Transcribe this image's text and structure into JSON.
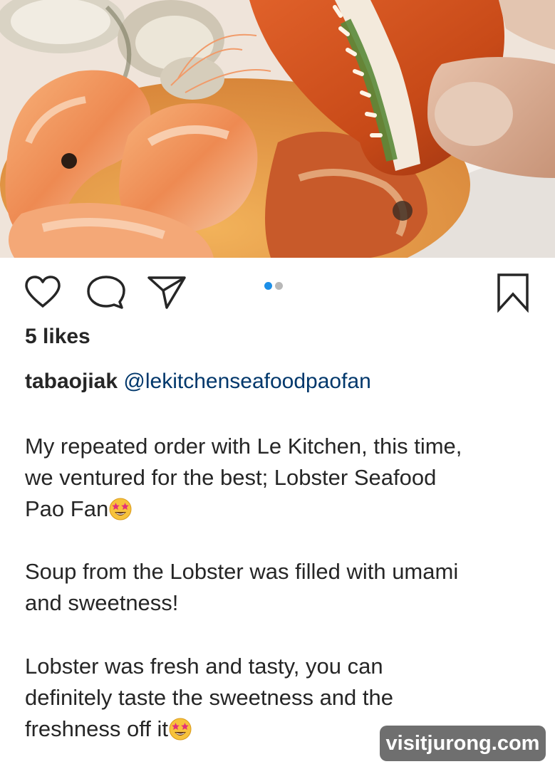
{
  "post": {
    "photo_description": "",
    "carousel": {
      "count": 2,
      "active_index": 0
    },
    "likes_text": "5 likes",
    "author": "tabaojiak",
    "mention": "@lekitchenseafoodpaofan",
    "caption": {
      "paragraph1": {
        "line1": "My repeated order with Le Kitchen, this time,",
        "line2": "we ventured for the best; Lobster Seafood",
        "line3": "Pao Fan"
      },
      "paragraph2": {
        "line1": "Soup from the Lobster was filled with umami",
        "line2": "and sweetness!"
      },
      "paragraph3": {
        "line1": "Lobster was fresh and tasty, you can",
        "line2": "definitely taste the sweetness and the",
        "line3": "freshness off it"
      }
    }
  },
  "icons": {
    "like": "heart-icon",
    "comment": "comment-bubble-icon",
    "share": "paper-plane-icon",
    "save": "bookmark-icon",
    "emoji": "star-struck-emoji-icon"
  },
  "colors": {
    "text": "#262626",
    "mention": "#00376b",
    "active_dot": "#1c8fe8",
    "inactive_dot": "#b8b8b8",
    "watermark_bg": "#464646"
  },
  "watermark": {
    "text": "visitjurong.com"
  }
}
